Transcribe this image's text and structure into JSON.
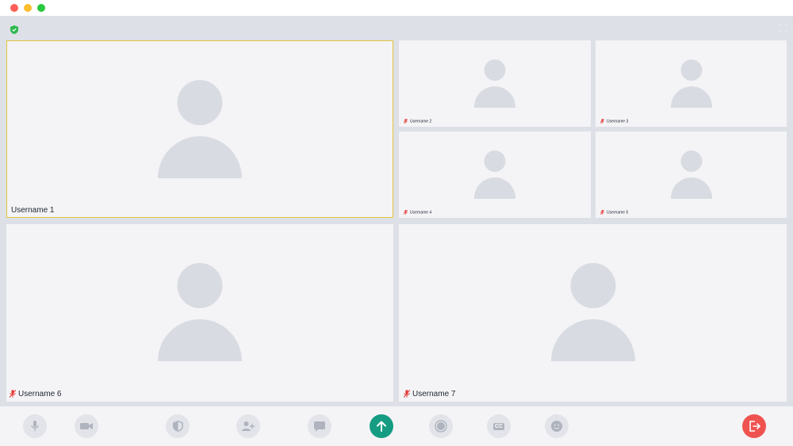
{
  "window": {
    "controls": [
      "close",
      "minimize",
      "maximize"
    ]
  },
  "meeting": {
    "secure_icon": "shield-check-icon",
    "fullscreen_icon": "fullscreen-icon"
  },
  "participants": [
    {
      "name": "Username 1",
      "active_speaker": true,
      "muted": false
    },
    {
      "name": "Username 2",
      "active_speaker": false,
      "muted": true
    },
    {
      "name": "Username 3",
      "active_speaker": false,
      "muted": true
    },
    {
      "name": "Username 4",
      "active_speaker": false,
      "muted": true
    },
    {
      "name": "Username 5",
      "active_speaker": false,
      "muted": true
    },
    {
      "name": "Username 6",
      "active_speaker": false,
      "muted": true
    },
    {
      "name": "Username 7",
      "active_speaker": false,
      "muted": true
    }
  ],
  "toolbar": {
    "items": [
      {
        "id": "microphone",
        "icon": "microphone-icon"
      },
      {
        "id": "camera",
        "icon": "video-camera-icon"
      },
      {
        "id": "security",
        "icon": "shield-icon"
      },
      {
        "id": "add-participant",
        "icon": "add-user-icon"
      },
      {
        "id": "chat",
        "icon": "chat-bubble-icon"
      },
      {
        "id": "share-screen",
        "icon": "arrow-up-icon"
      },
      {
        "id": "record",
        "icon": "record-icon"
      },
      {
        "id": "captions",
        "icon": "closed-captions-icon",
        "label": "CC"
      },
      {
        "id": "reactions",
        "icon": "emoji-icon"
      },
      {
        "id": "leave",
        "icon": "exit-icon"
      }
    ]
  },
  "colors": {
    "accent": "#159c82",
    "danger": "#ef5350",
    "active_border": "#e3c43a",
    "muted_mic": "#e53935",
    "tile_bg": "#f4f4f7",
    "stage_bg": "#dde0e6",
    "avatar": "#d9dbe2"
  }
}
